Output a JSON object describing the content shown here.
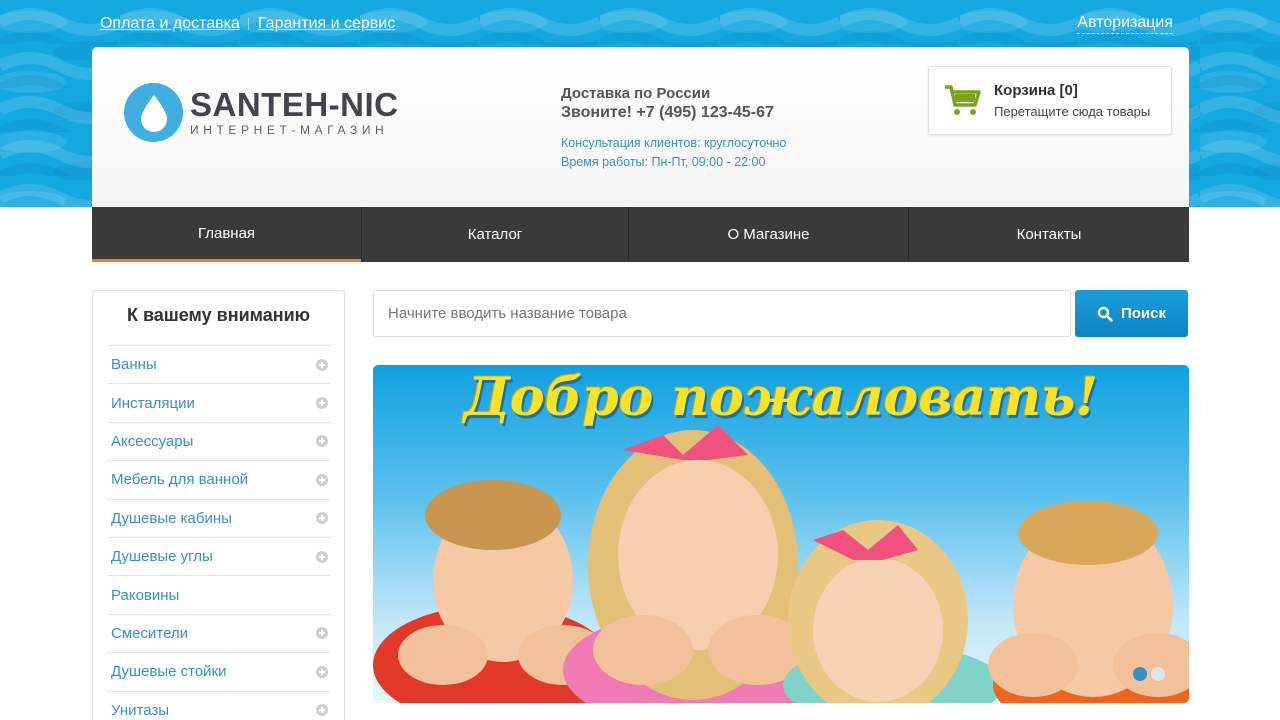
{
  "top_links": {
    "delivery": "Оплата и доставка",
    "warranty": "Гарантия и сервис",
    "auth": "Авторизация"
  },
  "logo": {
    "title": "SANTEH-NIC",
    "subtitle": "ИНТЕРНЕТ-МАГАЗИН",
    "icon": "water-drop-icon"
  },
  "contacts": {
    "delivery": "Доставка по России",
    "phone": "Звоните! +7 (495) 123-45-67",
    "consult": "Консультация клиентов: круглосуточно",
    "hours": "Время работы: Пн-Пт, 09:00 - 22:00"
  },
  "cart": {
    "title": "Корзина [0]",
    "hint": "Перетащите сюда товары",
    "icon": "shopping-cart-icon"
  },
  "nav": {
    "items": [
      {
        "label": "Главная",
        "active": true
      },
      {
        "label": "Каталог",
        "active": false
      },
      {
        "label": "О Магазине",
        "active": false
      },
      {
        "label": "Контакты",
        "active": false
      }
    ]
  },
  "sidebar": {
    "title": "К вашему вниманию",
    "items": [
      {
        "label": "Ванны",
        "expandable": true
      },
      {
        "label": "Инсталяции",
        "expandable": true
      },
      {
        "label": "Аксессуары",
        "expandable": true
      },
      {
        "label": "Мебель для ванной",
        "expandable": true
      },
      {
        "label": "Душевые кабины",
        "expandable": true
      },
      {
        "label": "Душевые углы",
        "expandable": true
      },
      {
        "label": "Раковины",
        "expandable": false
      },
      {
        "label": "Смесители",
        "expandable": true
      },
      {
        "label": "Душевые стойки",
        "expandable": true
      },
      {
        "label": "Унитазы",
        "expandable": true
      }
    ]
  },
  "search": {
    "placeholder": "Начните вводить название товара",
    "button": "Поиск",
    "icon": "search-icon"
  },
  "banner": {
    "title": "Добро пожаловать!",
    "slide_count": 2,
    "active_slide": 1
  },
  "colors": {
    "accent_blue": "#13a8e0",
    "nav_bg": "#3a3a3a",
    "nav_active": "#f07c1f",
    "link_blue": "#3a8fc4",
    "cart_green": "#7aa21d"
  }
}
